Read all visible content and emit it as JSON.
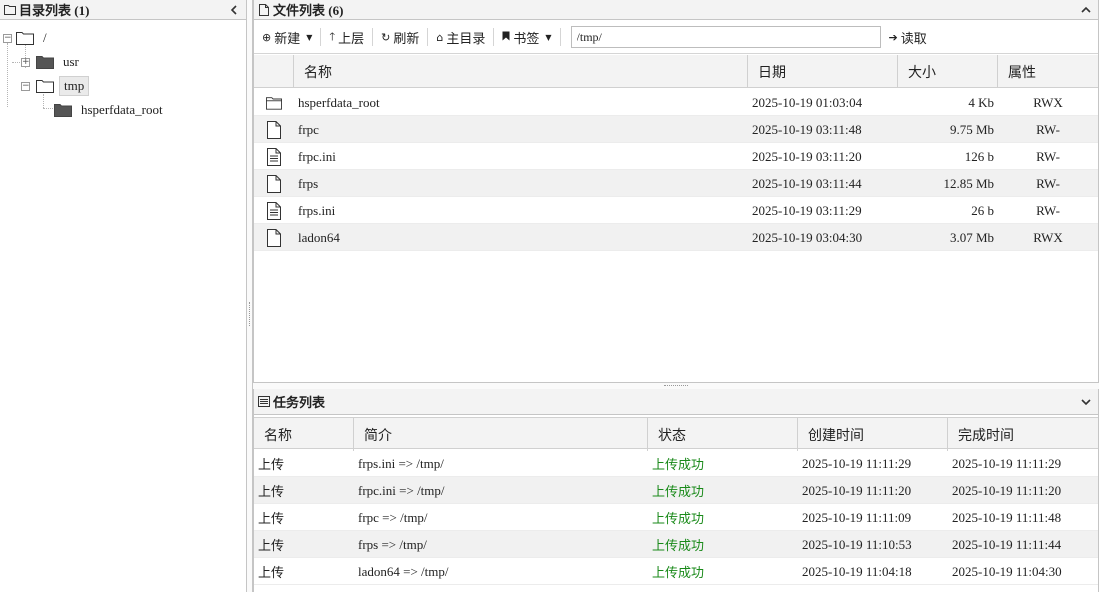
{
  "dir_panel": {
    "title": "目录列表 (1)",
    "tree": [
      {
        "label": "/"
      },
      {
        "label": "usr"
      },
      {
        "label": "tmp"
      },
      {
        "label": "hsperfdata_root"
      }
    ]
  },
  "file_panel": {
    "title": "文件列表 (6)",
    "toolbar": {
      "new_label": "新建",
      "up_label": "上层",
      "refresh_label": "刷新",
      "home_label": "主目录",
      "bookmark_label": "书签",
      "path_value": "/tmp/",
      "read_label": "读取"
    },
    "columns": {
      "name": "名称",
      "date": "日期",
      "size": "大小",
      "attr": "属性"
    },
    "files": [
      {
        "icon": "folder-icon",
        "name": "hsperfdata_root",
        "date": "2025-10-19 01:03:04",
        "size": "4 Kb",
        "attr": "RWX"
      },
      {
        "icon": "file-icon",
        "name": "frpc",
        "date": "2025-10-19 03:11:48",
        "size": "9.75 Mb",
        "attr": "RW-"
      },
      {
        "icon": "text-file-icon",
        "name": "frpc.ini",
        "date": "2025-10-19 03:11:20",
        "size": "126 b",
        "attr": "RW-"
      },
      {
        "icon": "file-icon",
        "name": "frps",
        "date": "2025-10-19 03:11:44",
        "size": "12.85 Mb",
        "attr": "RW-"
      },
      {
        "icon": "text-file-icon",
        "name": "frps.ini",
        "date": "2025-10-19 03:11:29",
        "size": "26 b",
        "attr": "RW-"
      },
      {
        "icon": "file-icon",
        "name": "ladon64",
        "date": "2025-10-19 03:04:30",
        "size": "3.07 Mb",
        "attr": "RWX"
      }
    ]
  },
  "task_panel": {
    "title": "任务列表",
    "columns": {
      "name": "名称",
      "desc": "简介",
      "status": "状态",
      "created": "创建时间",
      "finished": "完成时间"
    },
    "tasks": [
      {
        "name": "上传",
        "desc": "frps.ini => /tmp/",
        "status": "上传成功",
        "created": "2025-10-19 11:11:29",
        "finished": "2025-10-19 11:11:29"
      },
      {
        "name": "上传",
        "desc": "frpc.ini => /tmp/",
        "status": "上传成功",
        "created": "2025-10-19 11:11:20",
        "finished": "2025-10-19 11:11:20"
      },
      {
        "name": "上传",
        "desc": "frpc => /tmp/",
        "status": "上传成功",
        "created": "2025-10-19 11:11:09",
        "finished": "2025-10-19 11:11:48"
      },
      {
        "name": "上传",
        "desc": "frps => /tmp/",
        "status": "上传成功",
        "created": "2025-10-19 11:10:53",
        "finished": "2025-10-19 11:11:44"
      },
      {
        "name": "上传",
        "desc": "ladon64 => /tmp/",
        "status": "上传成功",
        "created": "2025-10-19 11:04:18",
        "finished": "2025-10-19 11:04:30"
      }
    ]
  },
  "colors": {
    "success": "#1a8a1a",
    "header_bg": "#f3f3f3",
    "border": "#c5c5c5"
  }
}
